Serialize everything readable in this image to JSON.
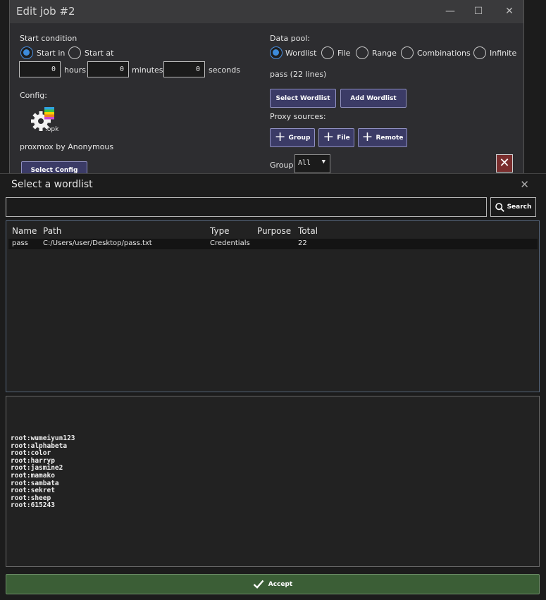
{
  "edit_job": {
    "title": "Edit job #2",
    "window_buttons": {
      "minimize": "—",
      "maximize": "☐",
      "close": "✕"
    },
    "start_condition": {
      "label": "Start condition",
      "option_start_in": "Start in",
      "option_start_at": "Start at",
      "selected": "Start in",
      "hours_value": "0",
      "hours_label": "hours",
      "minutes_value": "0",
      "minutes_label": "minutes",
      "seconds_value": "0",
      "seconds_label": "seconds"
    },
    "config": {
      "label": "Config:",
      "icon_ext": ".opk",
      "name": "proxmox by Anonymous",
      "select_button": "Select Config"
    },
    "data_pool": {
      "label": "Data pool:",
      "options": [
        "Wordlist",
        "File",
        "Range",
        "Combinations",
        "Infinite"
      ],
      "selected": "Wordlist",
      "info": "pass (22 lines)",
      "select_wordlist_button": "Select Wordlist",
      "add_wordlist_button": "Add Wordlist"
    },
    "proxy_sources": {
      "label": "Proxy sources:",
      "group_button": "Group",
      "file_button": "File",
      "remote_button": "Remote"
    },
    "group": {
      "label": "Group",
      "value": "All",
      "remove_symbol": "✕"
    }
  },
  "dialog": {
    "title": "Select a wordlist",
    "close_symbol": "✕",
    "search": {
      "value": "",
      "placeholder": "",
      "button_label": "Search"
    },
    "table": {
      "columns": [
        "Name",
        "Path",
        "Type",
        "Purpose",
        "Total"
      ],
      "rows": [
        {
          "name": "pass",
          "path": "C:/Users/user/Desktop/pass.txt",
          "type": "Credentials",
          "purpose": "",
          "total": "22"
        }
      ]
    },
    "preview_lines": [
      "root:wumeiyun123",
      "root:alphabeta",
      "root:color",
      "root:harryp",
      "root:jasmine2",
      "root:mamako",
      "root:sambata",
      "root:sekret",
      "root:sheep",
      "root:615243"
    ],
    "accept_button": "Accept"
  },
  "colors": {
    "accent_blue": "#3d8bdb",
    "button_purple": "#3b3b66",
    "accept_green": "#3b5e36",
    "remove_red": "#7a2e2e"
  }
}
